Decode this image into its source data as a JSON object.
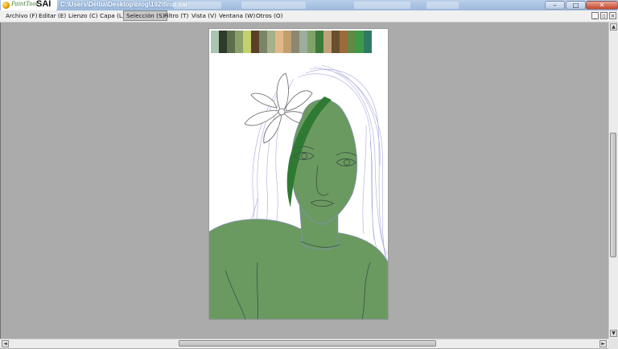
{
  "titlebar": {
    "logo_text": "PaintTool",
    "logo_sai": "SAI",
    "path": "C:\\Users\\Delba\\Desktop\\blog\\192\\final.sai"
  },
  "window_buttons": {
    "minimize": "–",
    "maximize": "□",
    "close": "✕"
  },
  "menu": {
    "items": [
      {
        "label": "Archivo (F)",
        "active": false
      },
      {
        "label": "Editar (E)",
        "active": false
      },
      {
        "label": "Lienzo (C)",
        "active": false
      },
      {
        "label": "Capa (L)",
        "active": false
      },
      {
        "label": "Selección (S)",
        "active": true
      },
      {
        "label": "Filtro (T)",
        "active": false
      },
      {
        "label": "Vista (V)",
        "active": false
      },
      {
        "label": "Ventana (W)",
        "active": false
      },
      {
        "label": "Otros (O)",
        "active": false
      }
    ],
    "mdi": {
      "minimize": "_",
      "restore": "▫",
      "close": "×"
    }
  },
  "canvas": {
    "palette": [
      "#a9c4b0",
      "#2f3a2a",
      "#5d6e4c",
      "#8c9f6b",
      "#c2d06e",
      "#5a4027",
      "#7c8467",
      "#a6b08a",
      "#e3b888",
      "#c1a06e",
      "#8a8773",
      "#9cae9b",
      "#7fa36a",
      "#3d7a3a",
      "#c0a27a",
      "#6a4f2e",
      "#9b6b3a",
      "#5f8a45",
      "#3f9a48",
      "#2f7a66"
    ],
    "skin_color": "#6b9a61",
    "hair_stripe_color": "#2f7a32",
    "line_color": "#8b8bd0"
  },
  "scrollbars": {
    "up": "▲",
    "down": "▼",
    "left": "◄",
    "right": "►"
  }
}
